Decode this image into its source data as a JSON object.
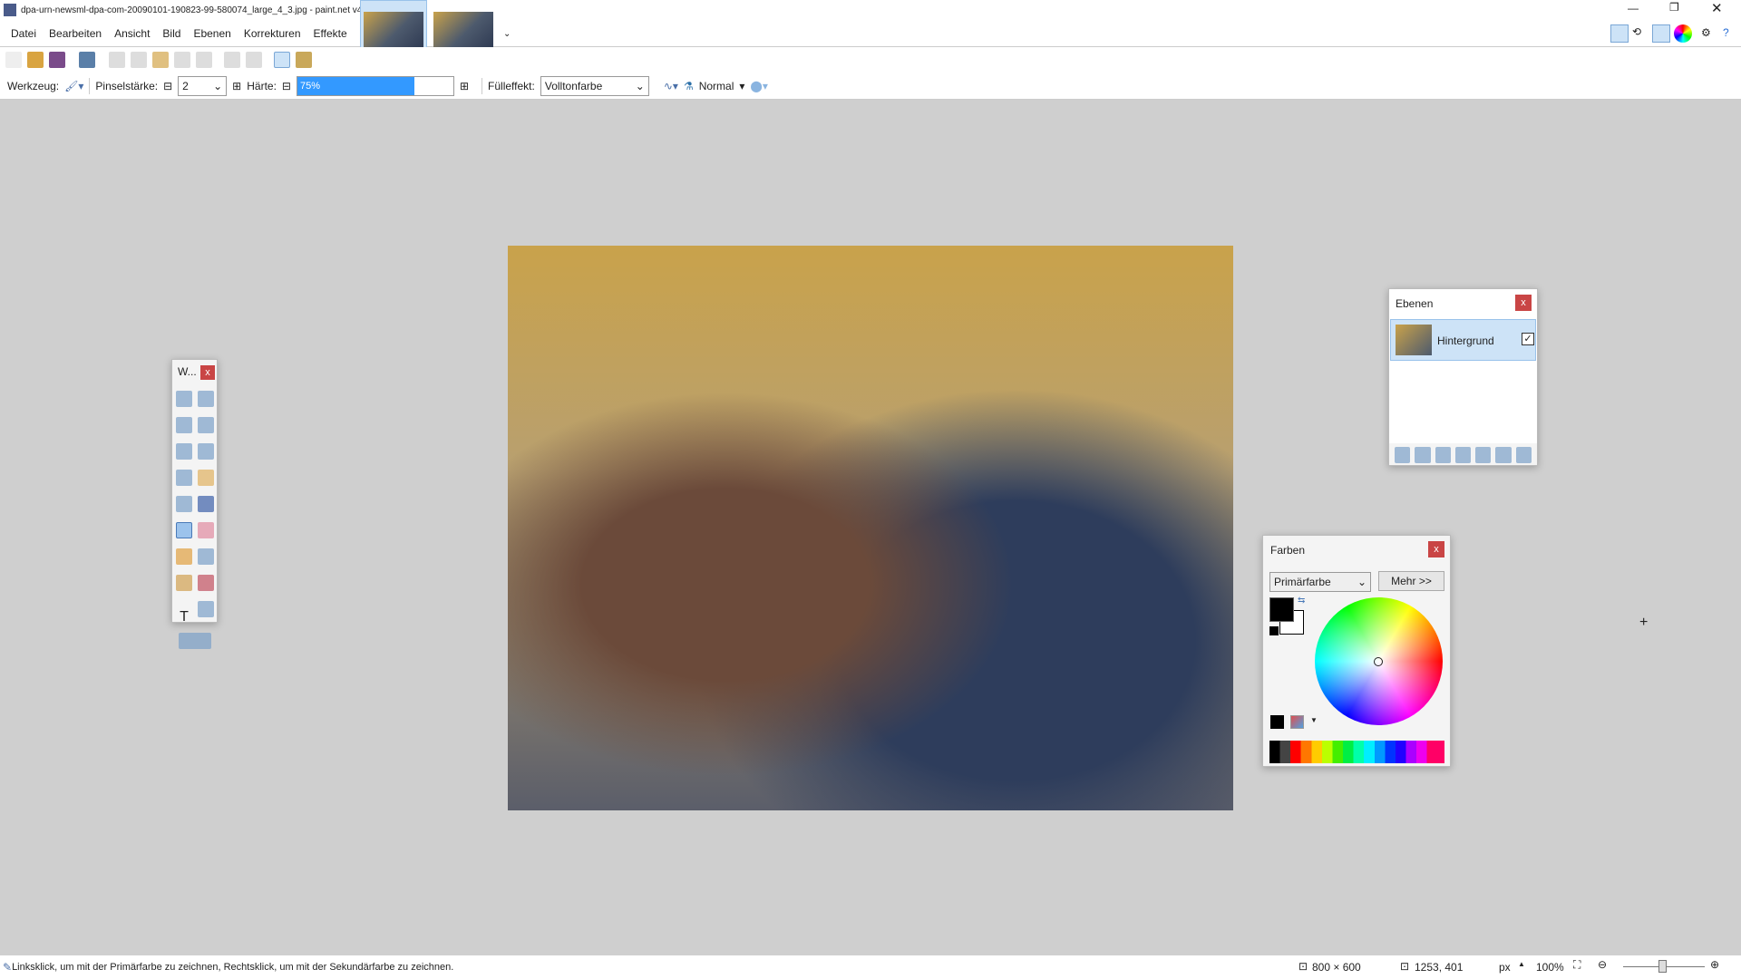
{
  "window": {
    "title": "dpa-urn-newsml-dpa-com-20090101-190823-99-580074_large_4_3.jpg - paint.net v4.2.11"
  },
  "menu": [
    "Datei",
    "Bearbeiten",
    "Ansicht",
    "Bild",
    "Ebenen",
    "Korrekturen",
    "Effekte"
  ],
  "options": {
    "tool_label": "Werkzeug:",
    "brush_label": "Pinselstärke:",
    "brush_value": "2",
    "hardness_label": "Härte:",
    "hardness_value": "75%",
    "hardness_fraction": 0.75,
    "fill_label": "Fülleffekt:",
    "fill_value": "Volltonfarbe",
    "blend_mode": "Normal"
  },
  "tools_window": {
    "title": "W..."
  },
  "layers": {
    "title": "Ebenen",
    "items": [
      {
        "name": "Hintergrund",
        "visible": true
      }
    ]
  },
  "colors": {
    "title": "Farben",
    "mode": "Primärfarbe",
    "more": "Mehr >>",
    "primary": "#000000",
    "secondary": "#ffffff"
  },
  "status": {
    "hint": "Linksklick, um mit der Primärfarbe zu zeichnen, Rechtsklick, um mit der Sekundärfarbe zu zeichnen.",
    "size": "800 × 600",
    "cursor": "1253, 401",
    "unit": "px",
    "zoom": "100%"
  }
}
